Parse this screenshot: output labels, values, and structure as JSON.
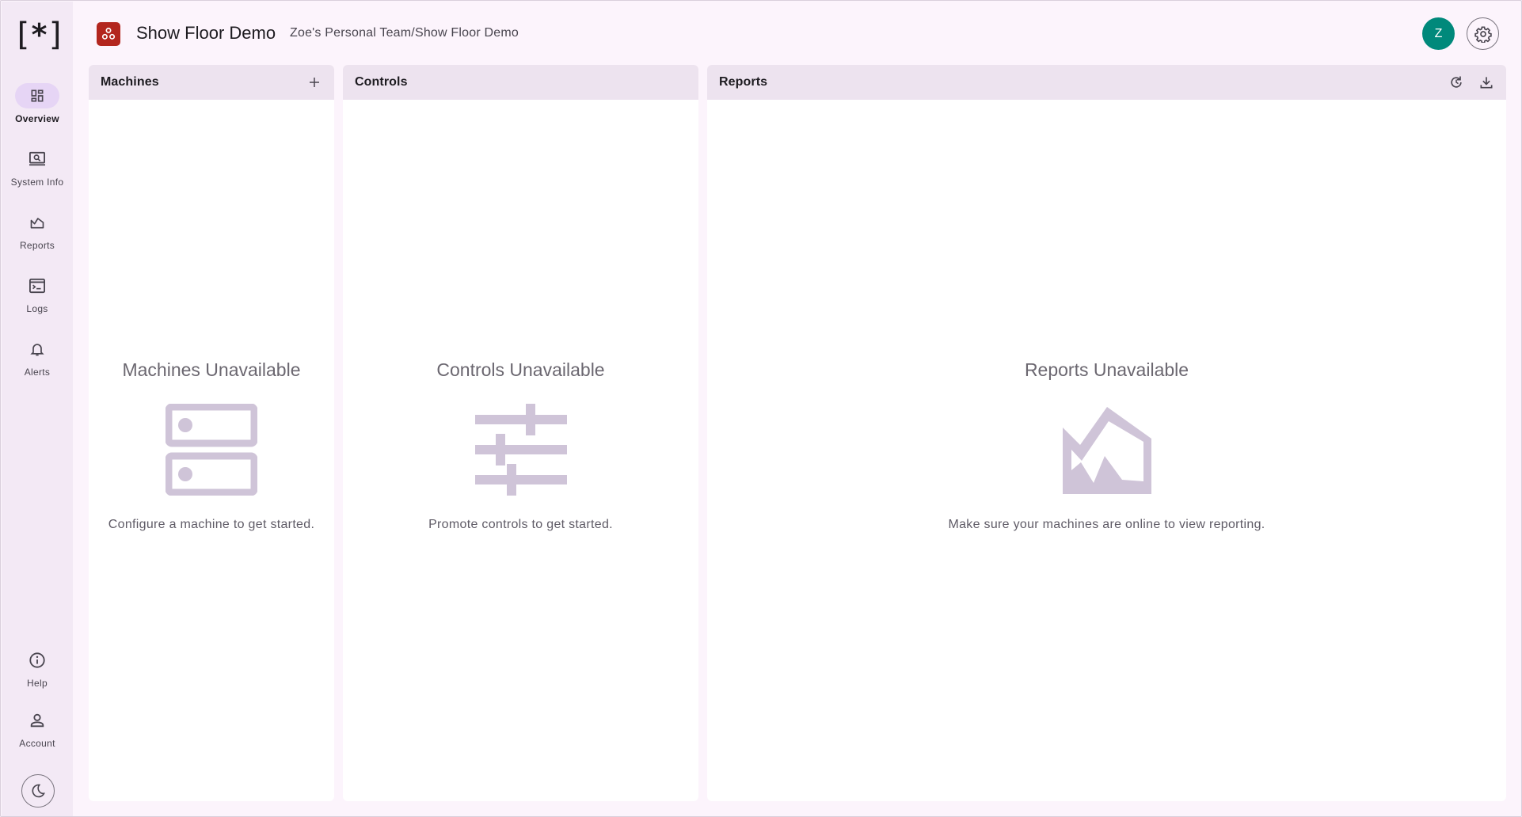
{
  "sidebar": {
    "logo": {
      "left": "[",
      "center": "*",
      "right": "]"
    },
    "items": [
      {
        "label": "Overview",
        "icon": "dashboard-icon",
        "active": true
      },
      {
        "label": "System Info",
        "icon": "system-info-icon",
        "active": false
      },
      {
        "label": "Reports",
        "icon": "reports-icon",
        "active": false
      },
      {
        "label": "Logs",
        "icon": "logs-icon",
        "active": false
      },
      {
        "label": "Alerts",
        "icon": "bell-icon",
        "active": false
      }
    ],
    "bottom_items": [
      {
        "label": "Help",
        "icon": "info-icon"
      },
      {
        "label": "Account",
        "icon": "person-icon"
      }
    ],
    "theme_toggle_icon": "moon-icon"
  },
  "header": {
    "badge_icon": "org-icon",
    "badge_color": "#b3261e",
    "title": "Show Floor Demo",
    "breadcrumb": "Zoe's Personal Team/Show Floor Demo",
    "avatar_initial": "Z",
    "avatar_color": "#00897b",
    "settings_icon": "gear-icon"
  },
  "panels": {
    "machines": {
      "title": "Machines",
      "action_icon": "plus-icon",
      "empty_title": "Machines Unavailable",
      "empty_icon": "servers-icon",
      "empty_message": "Configure a machine to get started."
    },
    "controls": {
      "title": "Controls",
      "empty_title": "Controls Unavailable",
      "empty_icon": "sliders-icon",
      "empty_message": "Promote controls to get started."
    },
    "reports": {
      "title": "Reports",
      "action_icons": [
        "refresh-icon",
        "download-icon"
      ],
      "empty_title": "Reports Unavailable",
      "empty_icon": "area-chart-icon",
      "empty_message": "Make sure your machines are online to view reporting."
    }
  },
  "colors": {
    "accent": "#e6d5f5",
    "illustration": "#cfc4d8",
    "sidebar_bg": "#f3e9f5",
    "panel_header_bg": "#ede3ef"
  }
}
